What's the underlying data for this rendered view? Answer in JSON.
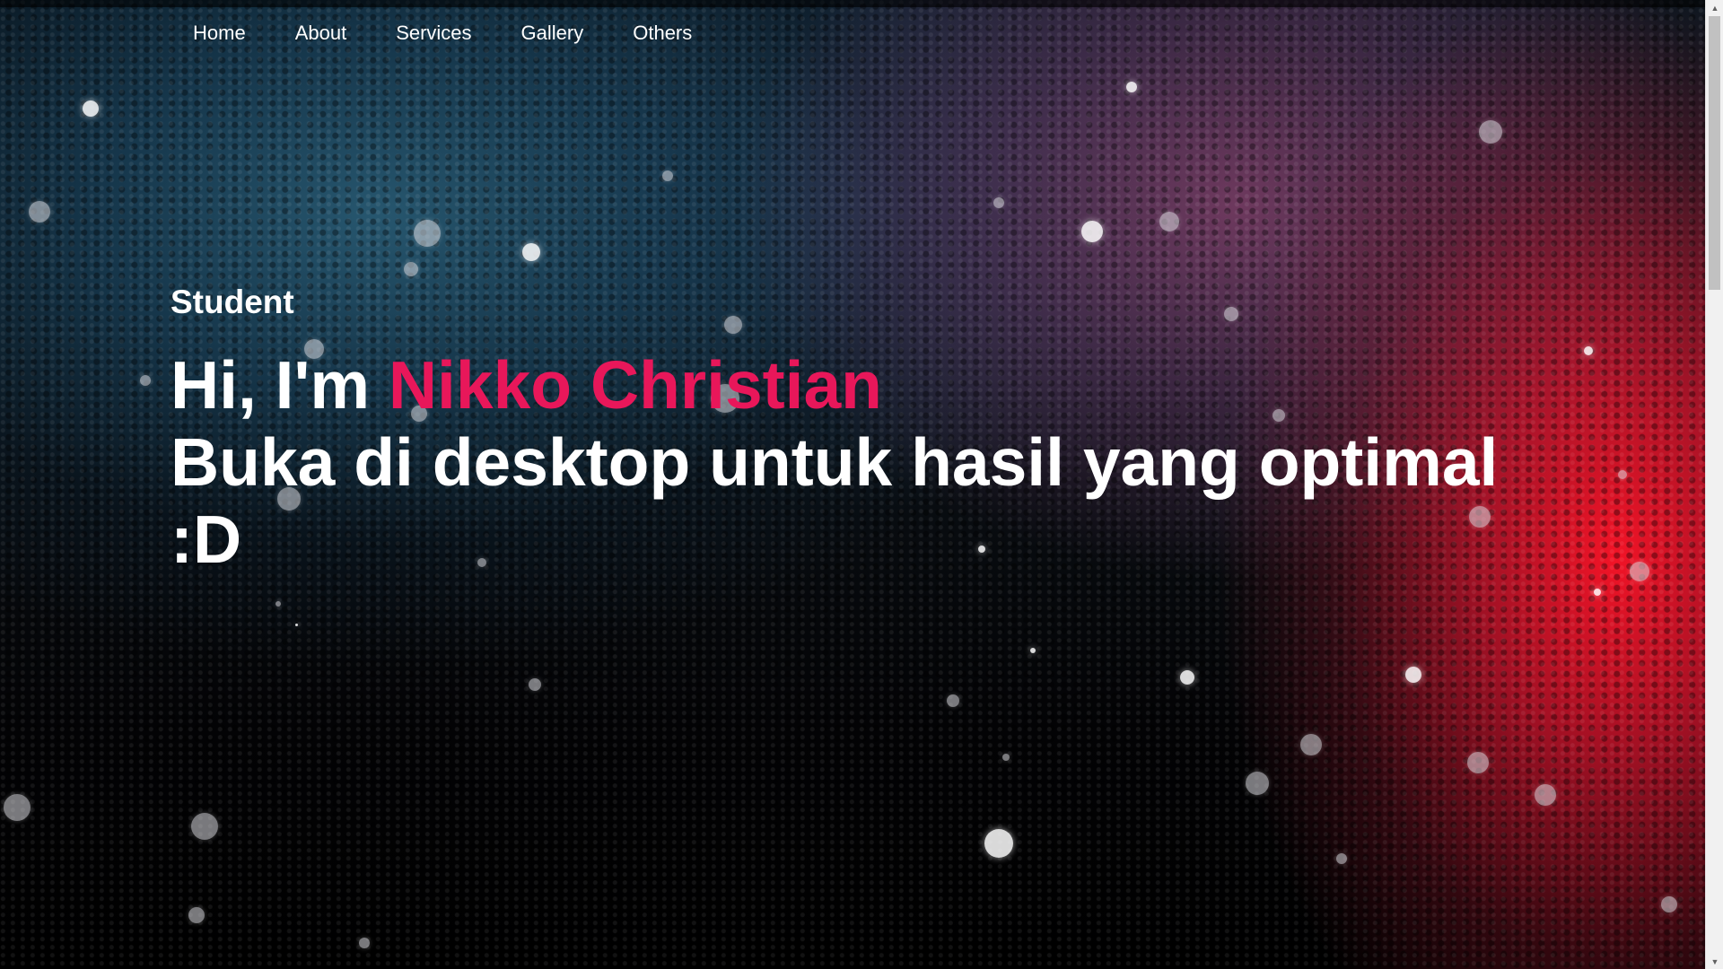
{
  "nav": {
    "items": [
      {
        "label": "Home"
      },
      {
        "label": "About"
      },
      {
        "label": "Services"
      },
      {
        "label": "Gallery"
      },
      {
        "label": "Others"
      }
    ]
  },
  "hero": {
    "subtitle": "Student",
    "greeting": "Hi, I'm ",
    "name": "Nikko Christian",
    "message": "Buka di desktop untuk hasil yang optimal :D"
  },
  "colors": {
    "accent": "#e8175a",
    "text": "#ffffff"
  },
  "icons": {
    "scroll_up": "triangle-up-icon",
    "scroll_down": "triangle-down-icon"
  }
}
